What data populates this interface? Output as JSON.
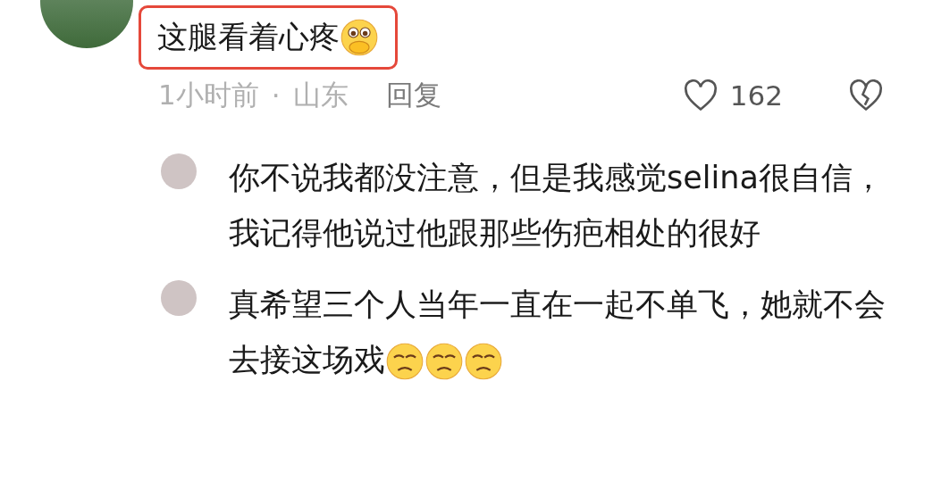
{
  "comment": {
    "text": "这腿看着心疼",
    "emojis": [
      {
        "kind": "shy"
      }
    ],
    "highlighted": true,
    "time": "1小时前",
    "separator": "·",
    "location": "山东",
    "reply_label": "回复",
    "likes": "162",
    "liked": false
  },
  "replies": [
    {
      "text": "你不说我都没注意，但是我感觉selina很自信，我记得他说过他跟那些伤疤相处的很好"
    },
    {
      "text": "真希望三个人当年一直在一起不单飞，她就不会去接这场戏",
      "emojis": [
        {
          "kind": "sad"
        },
        {
          "kind": "sad"
        },
        {
          "kind": "sad"
        }
      ]
    }
  ]
}
